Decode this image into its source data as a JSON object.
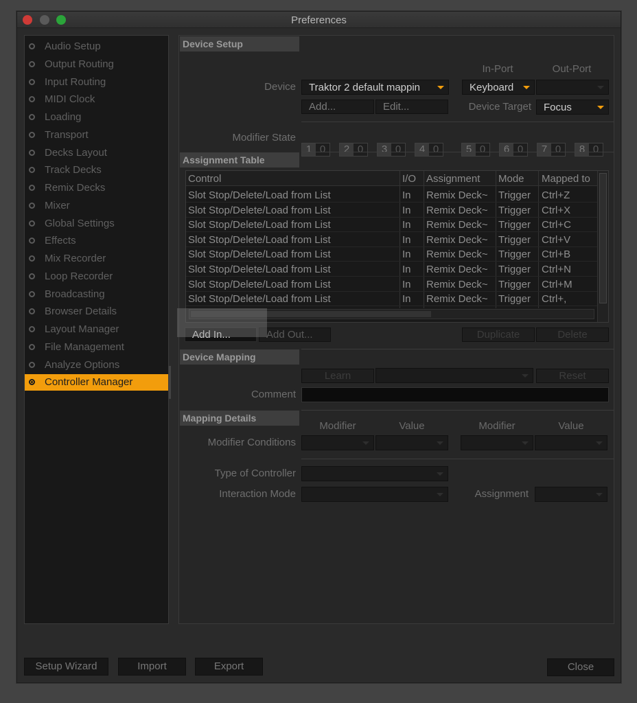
{
  "window": {
    "title": "Preferences"
  },
  "sidebar": {
    "items": [
      {
        "label": "Audio Setup"
      },
      {
        "label": "Output Routing"
      },
      {
        "label": "Input Routing"
      },
      {
        "label": "MIDI Clock"
      },
      {
        "label": "Loading"
      },
      {
        "label": "Transport"
      },
      {
        "label": "Decks Layout"
      },
      {
        "label": "Track Decks"
      },
      {
        "label": "Remix Decks"
      },
      {
        "label": "Mixer"
      },
      {
        "label": "Global Settings"
      },
      {
        "label": "Effects"
      },
      {
        "label": "Mix Recorder"
      },
      {
        "label": "Loop Recorder"
      },
      {
        "label": "Broadcasting"
      },
      {
        "label": "Browser Details"
      },
      {
        "label": "Layout Manager"
      },
      {
        "label": "File Management"
      },
      {
        "label": "Analyze Options"
      },
      {
        "label": "Controller Manager"
      }
    ],
    "selected": "Controller Manager"
  },
  "device_setup": {
    "heading": "Device Setup",
    "device_label": "Device",
    "device_value": "Traktor 2 default mappin",
    "in_port_label": "In-Port",
    "out_port_label": "Out-Port",
    "in_port_value": "Keyboard",
    "out_port_value": "",
    "add_label": "Add...",
    "edit_label": "Edit...",
    "device_target_label": "Device Target",
    "device_target_value": "Focus",
    "modifier_state_label": "Modifier State",
    "modifiers": [
      {
        "n": "1",
        "v": "0"
      },
      {
        "n": "2",
        "v": "0"
      },
      {
        "n": "3",
        "v": "0"
      },
      {
        "n": "4",
        "v": "0"
      },
      {
        "n": "5",
        "v": "0"
      },
      {
        "n": "6",
        "v": "0"
      },
      {
        "n": "7",
        "v": "0"
      },
      {
        "n": "8",
        "v": "0"
      }
    ]
  },
  "assignment_table": {
    "heading": "Assignment Table",
    "columns": [
      "Control",
      "I/O",
      "Assignment",
      "Mode",
      "Mapped to"
    ],
    "rows": [
      [
        "Slot Stop/Delete/Load from List",
        "In",
        "Remix Deck~",
        "Trigger",
        "Ctrl+Z"
      ],
      [
        "Slot Stop/Delete/Load from List",
        "In",
        "Remix Deck~",
        "Trigger",
        "Ctrl+X"
      ],
      [
        "Slot Stop/Delete/Load from List",
        "In",
        "Remix Deck~",
        "Trigger",
        "Ctrl+C"
      ],
      [
        "Slot Stop/Delete/Load from List",
        "In",
        "Remix Deck~",
        "Trigger",
        "Ctrl+V"
      ],
      [
        "Slot Stop/Delete/Load from List",
        "In",
        "Remix Deck~",
        "Trigger",
        "Ctrl+B"
      ],
      [
        "Slot Stop/Delete/Load from List",
        "In",
        "Remix Deck~",
        "Trigger",
        "Ctrl+N"
      ],
      [
        "Slot Stop/Delete/Load from List",
        "In",
        "Remix Deck~",
        "Trigger",
        "Ctrl+M"
      ],
      [
        "Slot Stop/Delete/Load from List",
        "In",
        "Remix Deck~",
        "Trigger",
        "Ctrl+,"
      ]
    ],
    "add_in_label": "Add In...",
    "add_out_label": "Add Out...",
    "duplicate_label": "Duplicate",
    "delete_label": "Delete"
  },
  "device_mapping": {
    "heading": "Device Mapping",
    "learn_label": "Learn",
    "reset_label": "Reset",
    "comment_label": "Comment",
    "comment_value": ""
  },
  "mapping_details": {
    "heading": "Mapping Details",
    "modifier_label_1": "Modifier",
    "value_label_1": "Value",
    "modifier_label_2": "Modifier",
    "value_label_2": "Value",
    "modifier_conditions_label": "Modifier Conditions",
    "type_of_controller_label": "Type of Controller",
    "interaction_mode_label": "Interaction Mode",
    "assignment_label": "Assignment"
  },
  "footer": {
    "setup_wizard_label": "Setup Wizard",
    "import_label": "Import",
    "export_label": "Export",
    "close_label": "Close"
  },
  "colors": {
    "accent": "#f29d0c",
    "window_bg": "#2a2a2a",
    "sidebar_bg": "#181818"
  }
}
